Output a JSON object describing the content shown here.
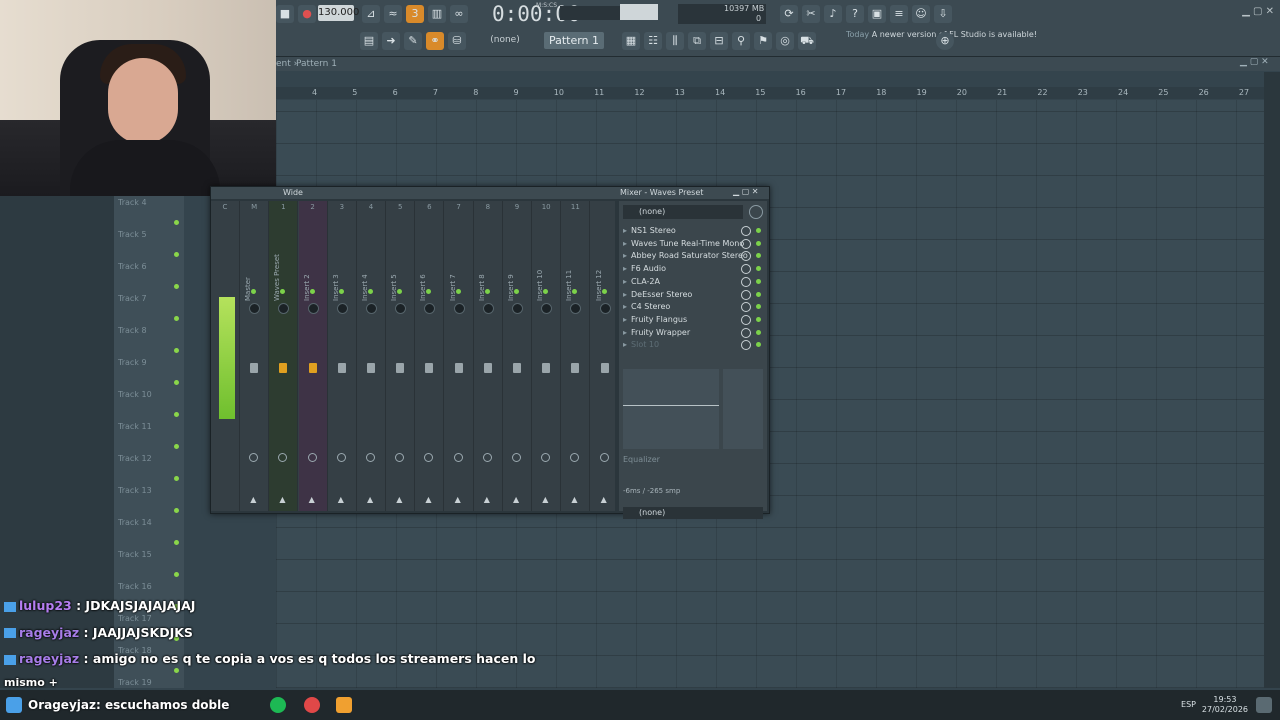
{
  "toolbar": {
    "tempo": "130.000",
    "time": "0:00:00",
    "time_unit": "M:S:CS",
    "cpu_line1": "10",
    "cpu_line2": "397 MB",
    "cpu_line3": "0",
    "pattern": "Pattern 1",
    "snap": "(none)",
    "news_label": "Today",
    "news_text": "A newer version of FL Studio is available!"
  },
  "playlist": {
    "header": "Pattern 1",
    "ruler": [
      "4",
      "5",
      "6",
      "7",
      "8",
      "9",
      "10",
      "11",
      "12",
      "13",
      "14",
      "15",
      "16",
      "17",
      "18",
      "19",
      "20",
      "21",
      "22",
      "23",
      "24",
      "25",
      "26",
      "27"
    ],
    "tracks": [
      "Track 4",
      "Track 5",
      "Track 6",
      "Track 7",
      "Track 8",
      "Track 9",
      "Track 10",
      "Track 11",
      "Track 12",
      "Track 13",
      "Track 14",
      "Track 15",
      "Track 16",
      "Track 17",
      "Track 18",
      "Track 19"
    ]
  },
  "mixer": {
    "left_title": "Wide",
    "title": "Mixer - Waves Preset",
    "strip_numbers": [
      "C",
      "M",
      "1",
      "2",
      "3",
      "4",
      "5",
      "6",
      "7",
      "8",
      "9",
      "10",
      "11"
    ],
    "strip_names": [
      "",
      "Master",
      "Waves Preset",
      "Insert 2",
      "Insert 3",
      "Insert 4",
      "Insert 5",
      "Insert 6",
      "Insert 7",
      "Insert 8",
      "Insert 9",
      "Insert 10",
      "Insert 11",
      "Insert 12"
    ],
    "preset": "(none)",
    "slots": [
      "NS1 Stereo",
      "Waves Tune Real-Time Mono",
      "Abbey Road Saturator Stereo",
      "F6 Audio",
      "CLA-2A",
      "DeEsser Stereo",
      "C4 Stereo",
      "Fruity Flangus",
      "Fruity Wrapper",
      "Slot 10"
    ],
    "eq_label": "Equalizer",
    "latency": "-6ms / -265 smp",
    "output": "(none)"
  },
  "chat": [
    {
      "user": "lulup23",
      "text": ": JDKAJSJAJAJAJAJ"
    },
    {
      "user": "rageyjaz",
      "text": ": JAAJJAJSKDJKS"
    },
    {
      "user": "rageyjaz",
      "text": ": amigo no es q te copia a vos es q todos los streamers hacen lo"
    },
    {
      "user": "",
      "text": "mismo +"
    }
  ],
  "taskbar": {
    "banner": "Orageyjaz: escuchamos doble",
    "lang": "ESP",
    "time": "19:53",
    "date": "27/02/2026"
  }
}
